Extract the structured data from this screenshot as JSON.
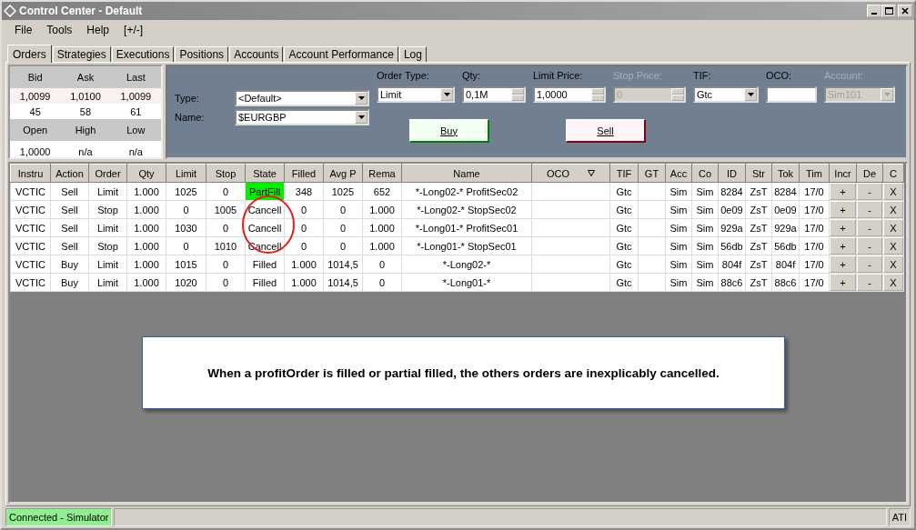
{
  "window": {
    "title": "Control Center - Default"
  },
  "menu": [
    "File",
    "Tools",
    "Help",
    "[+/-]"
  ],
  "tabs": [
    {
      "label": "Orders",
      "selected": true
    },
    {
      "label": "Strategies",
      "selected": false
    },
    {
      "label": "Executions",
      "selected": false
    },
    {
      "label": "Positions",
      "selected": false
    },
    {
      "label": "Accounts",
      "selected": false
    },
    {
      "label": "Account Performance",
      "selected": false
    },
    {
      "label": "Log",
      "selected": false
    }
  ],
  "quote": {
    "headers1": [
      "Bid",
      "Ask",
      "Last"
    ],
    "prices": [
      "1,0099",
      "1,0100",
      "1,0099"
    ],
    "sizes": [
      "45",
      "58",
      "61"
    ],
    "headers2": [
      "Open",
      "High",
      "Low"
    ],
    "values2": [
      "1,0000",
      "n/a",
      "n/a"
    ]
  },
  "order_form": {
    "type": {
      "label": "Type:",
      "value": "<Default>"
    },
    "name": {
      "label": "Name:",
      "value": "$EURGBP"
    },
    "fields": [
      {
        "label": "Order Type:",
        "kind": "dropdown",
        "value": "Limit",
        "disabled": false
      },
      {
        "label": "Qty:",
        "kind": "spinner",
        "value": "0,1M",
        "disabled": false
      },
      {
        "label": "Limit Price:",
        "kind": "spinner",
        "value": "1,0000",
        "disabled": false
      },
      {
        "label": "Stop Price:",
        "kind": "spinner",
        "value": "0",
        "disabled": true
      },
      {
        "label": "TIF:",
        "kind": "dropdown",
        "value": "Gtc",
        "disabled": false
      },
      {
        "label": "OCO:",
        "kind": "text",
        "disabled": false
      },
      {
        "label": "Account:",
        "kind": "dropdown",
        "value": "Sim101",
        "disabled": true
      }
    ],
    "buy": "Buy",
    "sell": "Sell"
  },
  "table": {
    "columns": [
      {
        "label": "Instru"
      },
      {
        "label": "Action"
      },
      {
        "label": "Order"
      },
      {
        "label": "Qty"
      },
      {
        "label": "Limit"
      },
      {
        "label": "Stop"
      },
      {
        "label": "State"
      },
      {
        "label": "Filled"
      },
      {
        "label": "Avg P"
      },
      {
        "label": "Rema"
      },
      {
        "label": "Name"
      },
      {
        "label": "OCO",
        "sort_icon": true
      },
      {
        "label": "TIF"
      },
      {
        "label": "GT"
      },
      {
        "label": "Acc"
      },
      {
        "label": "Co"
      },
      {
        "label": "ID"
      },
      {
        "label": "Str"
      },
      {
        "label": "Tok"
      },
      {
        "label": "Tim"
      },
      {
        "label": "Incr"
      },
      {
        "label": "De"
      },
      {
        "label": "C"
      }
    ],
    "rows": [
      {
        "cells": [
          "VCTIC",
          "Sell",
          "Limit",
          "1.000",
          "1025",
          "0",
          "PartFill",
          "348",
          "1025",
          "652",
          "*-Long02-* ProfitSec02",
          "",
          "Gtc",
          "",
          "Sim",
          "Sim",
          "8284",
          "ZsT",
          "8284",
          "17/0"
        ],
        "state_highlight": true,
        "buttons": [
          "+",
          "-",
          "X"
        ]
      },
      {
        "cells": [
          "VCTIC",
          "Sell",
          "Stop",
          "1.000",
          "0",
          "1005",
          "Cancell",
          "0",
          "0",
          "1.000",
          "*-Long02-* StopSec02",
          "",
          "Gtc",
          "",
          "Sim",
          "Sim",
          "0e09",
          "ZsT",
          "0e09",
          "17/0"
        ],
        "state_highlight": false,
        "buttons": [
          "+",
          "-",
          "X"
        ]
      },
      {
        "cells": [
          "VCTIC",
          "Sell",
          "Limit",
          "1.000",
          "1030",
          "0",
          "Cancell",
          "0",
          "0",
          "1.000",
          "*-Long01-* ProfitSec01",
          "",
          "Gtc",
          "",
          "Sim",
          "Sim",
          "929a",
          "ZsT",
          "929a",
          "17/0"
        ],
        "state_highlight": false,
        "buttons": [
          "+",
          "-",
          "X"
        ]
      },
      {
        "cells": [
          "VCTIC",
          "Sell",
          "Stop",
          "1.000",
          "0",
          "1010",
          "Cancell",
          "0",
          "0",
          "1.000",
          "*-Long01-* StopSec01",
          "",
          "Gtc",
          "",
          "Sim",
          "Sim",
          "56db",
          "ZsT",
          "56db",
          "17/0"
        ],
        "state_highlight": false,
        "buttons": [
          "+",
          "-",
          "X"
        ]
      },
      {
        "cells": [
          "VCTIC",
          "Buy",
          "Limit",
          "1.000",
          "1015",
          "0",
          "Filled",
          "1.000",
          "1014,5",
          "0",
          "*-Long02-*",
          "",
          "Gtc",
          "",
          "Sim",
          "Sim",
          "804f",
          "ZsT",
          "804f",
          "17/0"
        ],
        "state_highlight": false,
        "buttons": [
          "+",
          "-",
          "X"
        ]
      },
      {
        "cells": [
          "VCTIC",
          "Buy",
          "Limit",
          "1.000",
          "1020",
          "0",
          "Filled",
          "1.000",
          "1014,5",
          "0",
          "*-Long01-*",
          "",
          "Gtc",
          "",
          "Sim",
          "Sim",
          "88c6",
          "ZsT",
          "88c6",
          "17/0"
        ],
        "state_highlight": false,
        "buttons": [
          "+",
          "-",
          "X"
        ]
      }
    ]
  },
  "callout": "When a profitOrder is filled or partial filled, the others orders are inexplicably cancelled.",
  "status_bar": {
    "connection": "Connected - Simulator",
    "provider": "ATI"
  }
}
